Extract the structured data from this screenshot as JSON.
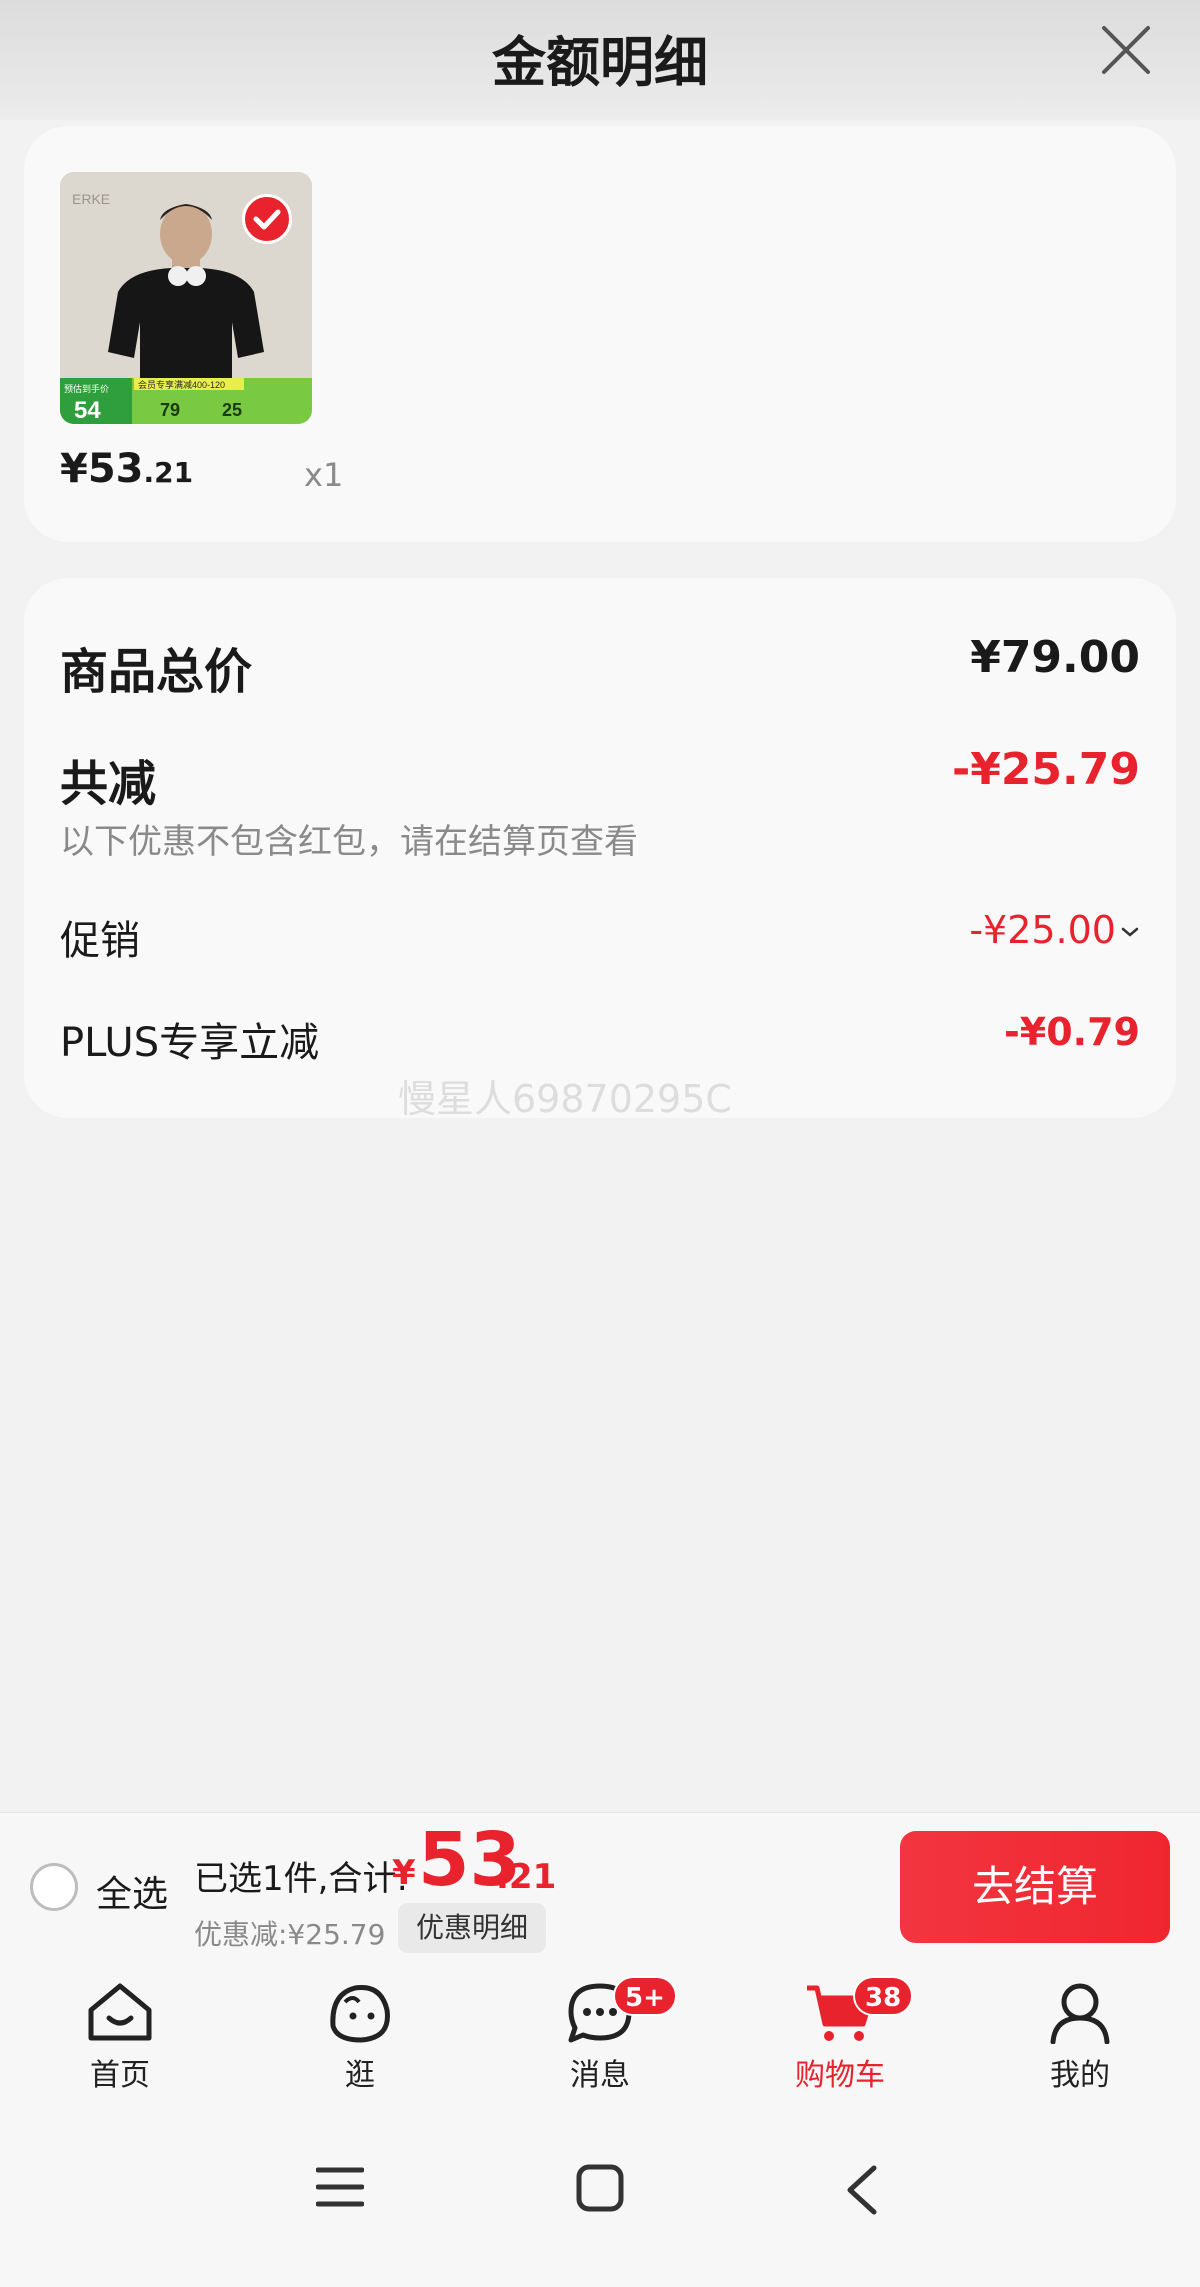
{
  "header": {
    "title": "金额明细",
    "close_icon": "close-icon"
  },
  "product": {
    "price_int": "¥53",
    "price_dec": ".21",
    "quantity": "x1",
    "selected": true,
    "thumb_text": {
      "brand": "ERKE",
      "promo_banner": "会员专享满减400-120",
      "label_a": "预估到手价",
      "price_a": "54",
      "price_b": "79",
      "price_c": "25"
    }
  },
  "summary": {
    "total_label": "商品总价",
    "total_value": "¥79.00",
    "reduce_label": "共减",
    "reduce_value": "-¥25.79",
    "reduce_note": "以下优惠不包含红包，请在结算页查看",
    "promo_label": "促销",
    "promo_value": "-¥25.00",
    "plus_label": "PLUS专享立减",
    "plus_value": "-¥0.79"
  },
  "watermark": "慢星人69870295C",
  "checkout": {
    "select_all_label": "全选",
    "selected_text": "已选1件,合计:",
    "currency": "¥",
    "total_int": "53",
    "total_dec": ".21",
    "discount_text": "优惠减:¥25.79",
    "discount_detail_label": "优惠明细",
    "checkout_label": "去结算"
  },
  "tabs": [
    {
      "label": "首页",
      "icon": "home-icon",
      "active": false
    },
    {
      "label": "逛",
      "icon": "browse-face-icon",
      "active": false
    },
    {
      "label": "消息",
      "icon": "message-icon",
      "badge": "5+",
      "active": false
    },
    {
      "label": "购物车",
      "icon": "cart-icon",
      "badge": "38",
      "active": true
    },
    {
      "label": "我的",
      "icon": "profile-icon",
      "active": false
    }
  ],
  "colors": {
    "accent": "#e8232d",
    "background": "#f2f2f2",
    "card": "#f9f9f9"
  }
}
